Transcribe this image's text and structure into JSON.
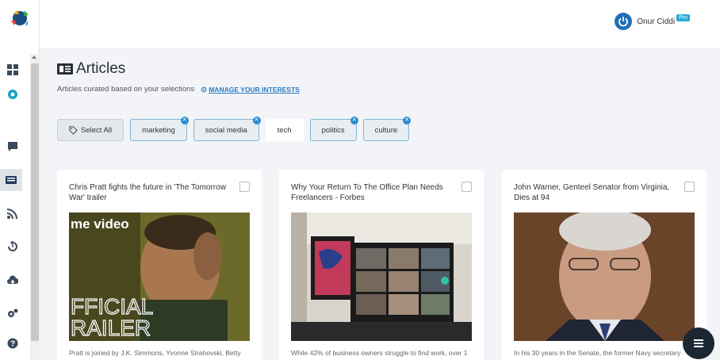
{
  "sidebar": {
    "icons": [
      "dashboard-icon",
      "gear-badge-icon",
      "chat-icon",
      "articles-icon",
      "rss-icon",
      "history-icon",
      "cloud-download-icon",
      "settings-icon",
      "help-icon"
    ]
  },
  "user": {
    "name": "Onur Ciddi",
    "badge": "Pro"
  },
  "page": {
    "title": "Articles",
    "subtitle": "Articles curated based on your selections",
    "manage_link": "MANAGE YOUR INTERESTS"
  },
  "tags": {
    "select_all": "Select All",
    "items": [
      {
        "label": "marketing",
        "selected": true
      },
      {
        "label": "social media",
        "selected": true
      },
      {
        "label": "tech",
        "selected": false
      },
      {
        "label": "politics",
        "selected": true
      },
      {
        "label": "culture",
        "selected": true
      }
    ]
  },
  "articles": [
    {
      "title": "Chris Pratt fights the future in 'The Tomorrow War' trailer",
      "image_text": [
        "me video",
        "FFICIAL",
        "RAILER"
      ],
      "description": "Pratt is joined by J.K. Simmons, Yvonne Strahovski, Betty"
    },
    {
      "title": "Why Your Return To The Office Plan Needs Freelancers - Forbes",
      "description": "While 42% of business owners struggle to find work, over 1"
    },
    {
      "title": "John Warner, Genteel Senator from Virginia, Dies at 94",
      "description": "In his 30 years in the Senate, the former Navy secretary"
    }
  ],
  "colors": {
    "accent": "#2a8ed0",
    "link": "#2a7cc7",
    "fab": "#1d2733"
  }
}
